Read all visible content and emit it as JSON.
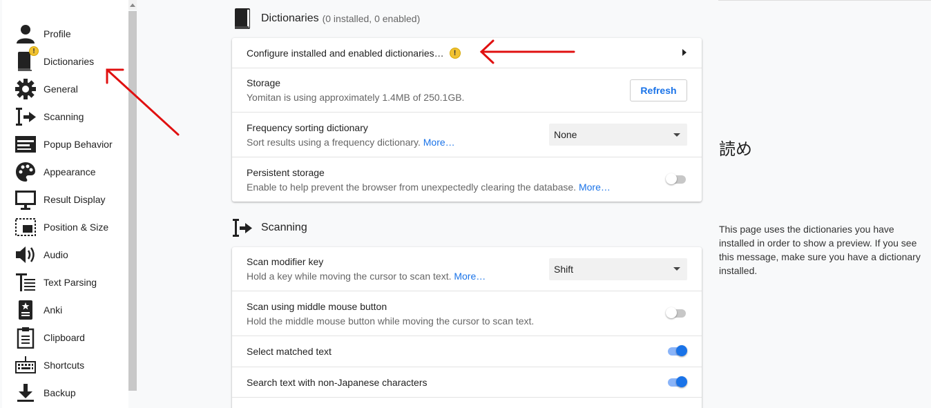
{
  "sidebar": {
    "items": [
      {
        "label": "Profile",
        "icon": "person-icon"
      },
      {
        "label": "Dictionaries",
        "icon": "book-icon",
        "badge": "!"
      },
      {
        "label": "General",
        "icon": "gear-icon"
      },
      {
        "label": "Scanning",
        "icon": "cursor-arrow-icon"
      },
      {
        "label": "Popup Behavior",
        "icon": "popup-icon"
      },
      {
        "label": "Appearance",
        "icon": "palette-icon"
      },
      {
        "label": "Result Display",
        "icon": "monitor-icon"
      },
      {
        "label": "Position & Size",
        "icon": "position-size-icon"
      },
      {
        "label": "Audio",
        "icon": "speaker-icon"
      },
      {
        "label": "Text Parsing",
        "icon": "text-parsing-icon"
      },
      {
        "label": "Anki",
        "icon": "anki-card-icon"
      },
      {
        "label": "Clipboard",
        "icon": "clipboard-icon"
      },
      {
        "label": "Shortcuts",
        "icon": "keyboard-icon"
      },
      {
        "label": "Backup",
        "icon": "download-icon"
      }
    ]
  },
  "dictionaries": {
    "title": "Dictionaries",
    "subtitle": "(0 installed, 0 enabled)",
    "configure_label": "Configure installed and enabled dictionaries…",
    "configure_warning": "!",
    "storage_title": "Storage",
    "storage_desc": "Yomitan is using approximately 1.4MB of 250.1GB.",
    "refresh_label": "Refresh",
    "freq_title": "Frequency sorting dictionary",
    "freq_desc": "Sort results using a frequency dictionary.",
    "freq_more": "More…",
    "freq_value": "None",
    "persist_title": "Persistent storage",
    "persist_desc": "Enable to help prevent the browser from unexpectedly clearing the database.",
    "persist_more": "More…",
    "persist_enabled": false
  },
  "scanning": {
    "title": "Scanning",
    "modifier_title": "Scan modifier key",
    "modifier_desc": "Hold a key while moving the cursor to scan text.",
    "modifier_more": "More…",
    "modifier_value": "Shift",
    "middle_title": "Scan using middle mouse button",
    "middle_desc": "Hold the middle mouse button while moving the cursor to scan text.",
    "middle_enabled": false,
    "select_title": "Select matched text",
    "select_enabled": true,
    "nonjp_title": "Search text with non-Japanese characters",
    "nonjp_enabled": true
  },
  "preview": {
    "word": "読め",
    "message": "This page uses the dictionaries you have installed in order to show a preview. If you see this message, make sure you have a dictionary installed."
  },
  "colors": {
    "accent": "#1a73e8",
    "annotation_arrow": "#e01010",
    "warning": "#f1c232"
  }
}
